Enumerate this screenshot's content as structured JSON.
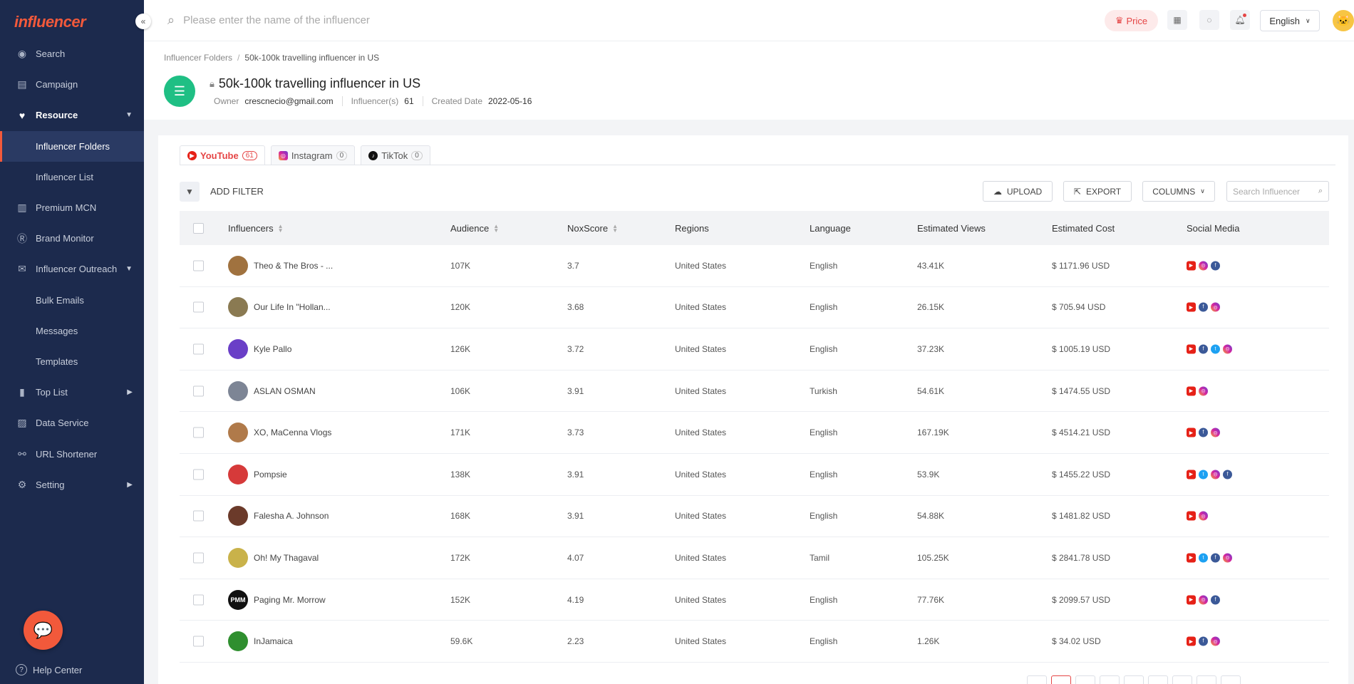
{
  "app": {
    "logo_text": "influencer",
    "brand_color": "#f2593b"
  },
  "sidebar": {
    "items": [
      {
        "label": "Search",
        "icon": "compass-icon",
        "bold": false,
        "sub": false
      },
      {
        "label": "Campaign",
        "icon": "document-icon",
        "bold": false,
        "sub": false
      },
      {
        "label": "Resource",
        "icon": "heart-icon",
        "bold": true,
        "sub": false,
        "arrow": "▼"
      },
      {
        "label": "Influencer Folders",
        "sub": true,
        "active": true
      },
      {
        "label": "Influencer List",
        "sub": true
      },
      {
        "label": "Premium MCN",
        "icon": "building-icon"
      },
      {
        "label": "Brand Monitor",
        "icon": "brand-icon"
      },
      {
        "label": "Influencer Outreach",
        "icon": "mail-icon",
        "arrow": "▼"
      },
      {
        "label": "Bulk Emails",
        "sub": true
      },
      {
        "label": "Messages",
        "sub": true
      },
      {
        "label": "Templates",
        "sub": true
      },
      {
        "label": "Top List",
        "icon": "bar-chart-icon",
        "arrow": "▶"
      },
      {
        "label": "Data Service",
        "icon": "line-chart-icon"
      },
      {
        "label": "URL Shortener",
        "icon": "link-icon"
      },
      {
        "label": "Setting",
        "icon": "gear-icon",
        "arrow": "▶"
      }
    ],
    "help_label": "Help Center"
  },
  "topbar": {
    "search_placeholder": "Please enter the name of the influencer",
    "price_label": "Price",
    "language": "English"
  },
  "header": {
    "breadcrumb_root": "Influencer Folders",
    "breadcrumb_current": "50k-100k travelling influencer in US",
    "title": "50k-100k travelling influencer in US",
    "owner_label": "Owner",
    "owner_value": "crescnecio@gmail.com",
    "influencers_label": "Influencer(s)",
    "influencers_value": "61",
    "created_label": "Created Date",
    "created_value": "2022-05-16"
  },
  "tabs": [
    {
      "label": "YouTube",
      "count": "61",
      "active": true
    },
    {
      "label": "Instagram",
      "count": "0",
      "active": false
    },
    {
      "label": "TikTok",
      "count": "0",
      "active": false
    }
  ],
  "toolbar": {
    "add_filter": "ADD FILTER",
    "upload": "UPLOAD",
    "export": "EXPORT",
    "columns": "COLUMNS",
    "search_placeholder": "Search Influencer"
  },
  "table": {
    "headers": [
      "Influencers",
      "Audience",
      "NoxScore",
      "Regions",
      "Language",
      "Estimated Views",
      "Estimated Cost",
      "Social Media"
    ],
    "rows": [
      {
        "name": "Theo & The Bros - ...",
        "audience": "107K",
        "score": "3.7",
        "region": "United States",
        "language": "English",
        "views": "43.41K",
        "cost": "$ 1171.96 USD",
        "social": [
          "yt",
          "ig",
          "fb"
        ],
        "avatar": "#a0723f"
      },
      {
        "name": "Our Life In \"Hollan...",
        "audience": "120K",
        "score": "3.68",
        "region": "United States",
        "language": "English",
        "views": "26.15K",
        "cost": "$ 705.94 USD",
        "social": [
          "yt",
          "fb",
          "ig"
        ],
        "avatar": "#8a7a52"
      },
      {
        "name": "Kyle Pallo",
        "audience": "126K",
        "score": "3.72",
        "region": "United States",
        "language": "English",
        "views": "37.23K",
        "cost": "$ 1005.19 USD",
        "social": [
          "yt",
          "fb",
          "tw",
          "ig"
        ],
        "avatar": "#6a3fc7"
      },
      {
        "name": "ASLAN OSMAN",
        "audience": "106K",
        "score": "3.91",
        "region": "United States",
        "language": "Turkish",
        "views": "54.61K",
        "cost": "$ 1474.55 USD",
        "social": [
          "yt",
          "ig"
        ],
        "avatar": "#7d8595"
      },
      {
        "name": "XO, MaCenna Vlogs",
        "audience": "171K",
        "score": "3.73",
        "region": "United States",
        "language": "English",
        "views": "167.19K",
        "cost": "$ 4514.21 USD",
        "social": [
          "yt",
          "fb",
          "ig"
        ],
        "avatar": "#b07a4a"
      },
      {
        "name": "Pompsie",
        "audience": "138K",
        "score": "3.91",
        "region": "United States",
        "language": "English",
        "views": "53.9K",
        "cost": "$ 1455.22 USD",
        "social": [
          "yt",
          "tw",
          "ig",
          "fb"
        ],
        "avatar": "#d63a3a"
      },
      {
        "name": "Falesha A. Johnson",
        "audience": "168K",
        "score": "3.91",
        "region": "United States",
        "language": "English",
        "views": "54.88K",
        "cost": "$ 1481.82 USD",
        "social": [
          "yt",
          "ig"
        ],
        "avatar": "#6b3a2a"
      },
      {
        "name": "Oh! My Thagaval",
        "audience": "172K",
        "score": "4.07",
        "region": "United States",
        "language": "Tamil",
        "views": "105.25K",
        "cost": "$ 2841.78 USD",
        "social": [
          "yt",
          "tw",
          "fb",
          "ig"
        ],
        "avatar": "#c9b24a"
      },
      {
        "name": "Paging Mr. Morrow",
        "audience": "152K",
        "score": "4.19",
        "region": "United States",
        "language": "English",
        "views": "77.76K",
        "cost": "$ 2099.57 USD",
        "social": [
          "yt",
          "ig",
          "fb"
        ],
        "avatar": "#111111",
        "avatar_text": "PMM"
      },
      {
        "name": "InJamaica",
        "audience": "59.6K",
        "score": "2.23",
        "region": "United States",
        "language": "English",
        "views": "1.26K",
        "cost": "$ 34.02 USD",
        "social": [
          "yt",
          "fb",
          "ig"
        ],
        "avatar": "#2f8f2f"
      }
    ]
  }
}
